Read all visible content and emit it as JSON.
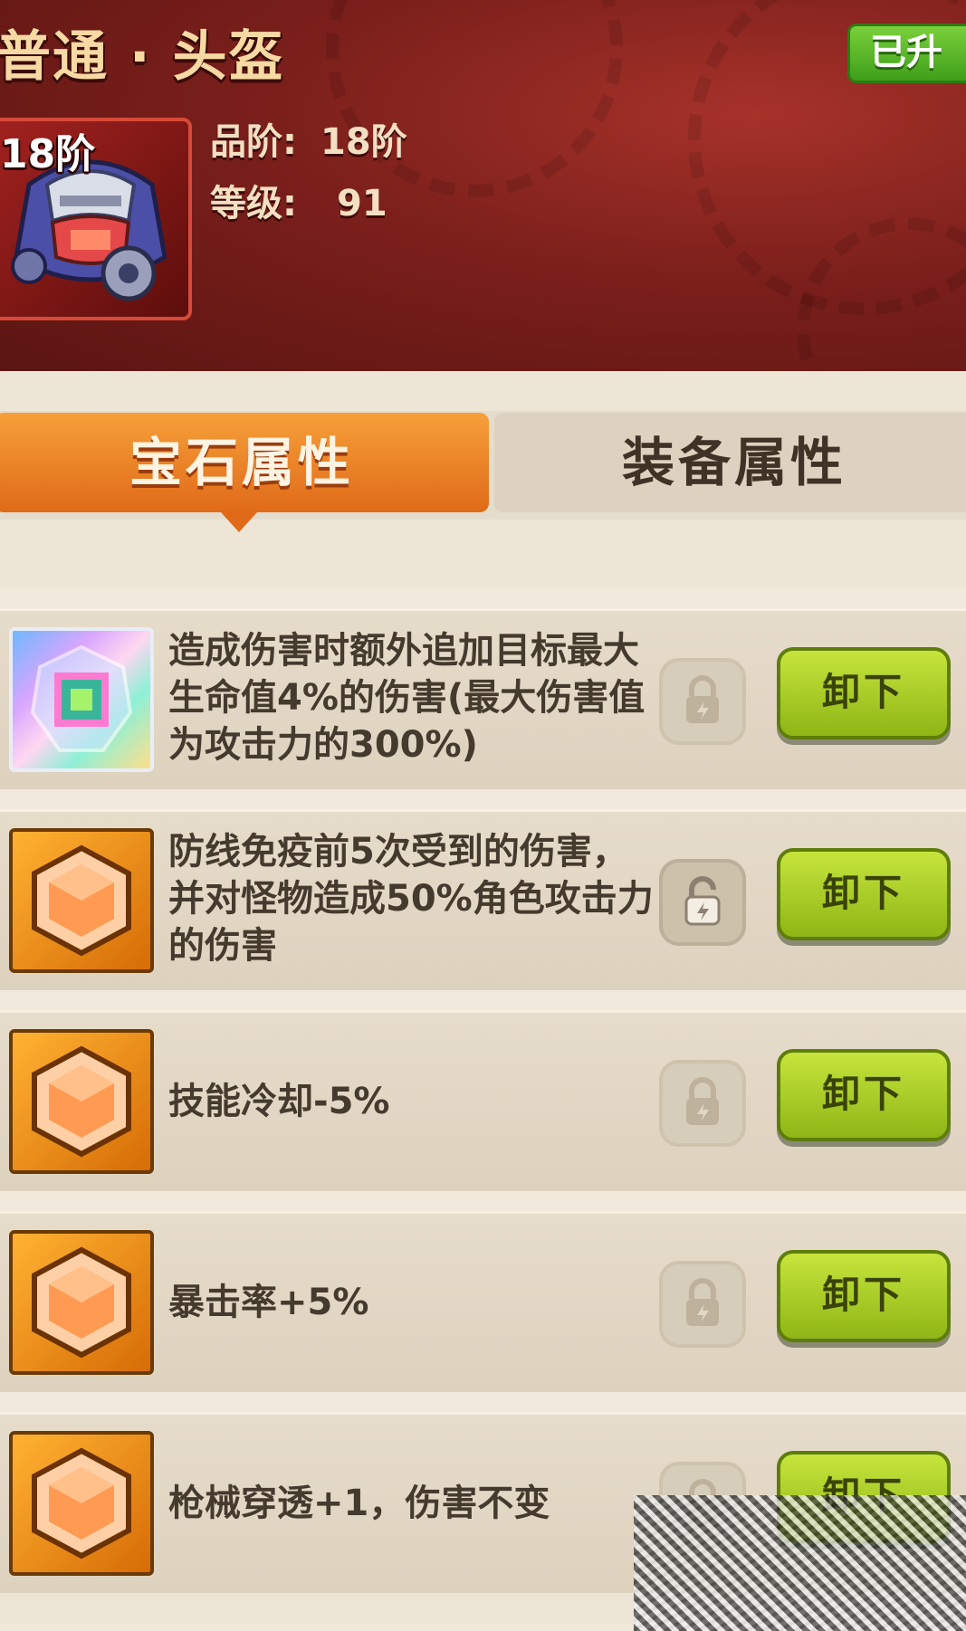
{
  "header": {
    "title": "普通 · 头盔",
    "upgraded_badge": "已升",
    "item": {
      "tier_badge": "18阶",
      "icon": "helmet-icon"
    },
    "rank_label": "品阶:",
    "rank_value": "18阶",
    "level_label": "等级:",
    "level_value": "91"
  },
  "tabs": [
    {
      "label": "宝石属性",
      "active": true
    },
    {
      "label": "装备属性",
      "active": false
    }
  ],
  "gems": [
    {
      "icon": "rainbow-gem-icon",
      "description": "造成伤害时额外追加目标最大生命值4%的伤害(最大伤害值为攻击力的300%)",
      "lock_icon": "lock-icon",
      "button": "卸下"
    },
    {
      "icon": "orange-gem-icon",
      "description": "防线免疫前5次受到的伤害，并对怪物造成50%角色攻击力的伤害",
      "lock_icon": "unlock-icon",
      "button": "卸下"
    },
    {
      "icon": "orange-gem-icon",
      "description": "技能冷却-5%",
      "lock_icon": "lock-icon",
      "button": "卸下"
    },
    {
      "icon": "orange-gem-icon",
      "description": "暴击率+5%",
      "lock_icon": "lock-icon",
      "button": "卸下"
    },
    {
      "icon": "orange-gem-icon",
      "description": "枪械穿透+1，伤害不变",
      "lock_icon": "lock-icon",
      "button": "卸下"
    }
  ],
  "colors": {
    "header_red": "#7b1f1b",
    "tab_active": "#f08a28",
    "button_green": "#a8cc22",
    "badge_green": "#5cb82a"
  }
}
